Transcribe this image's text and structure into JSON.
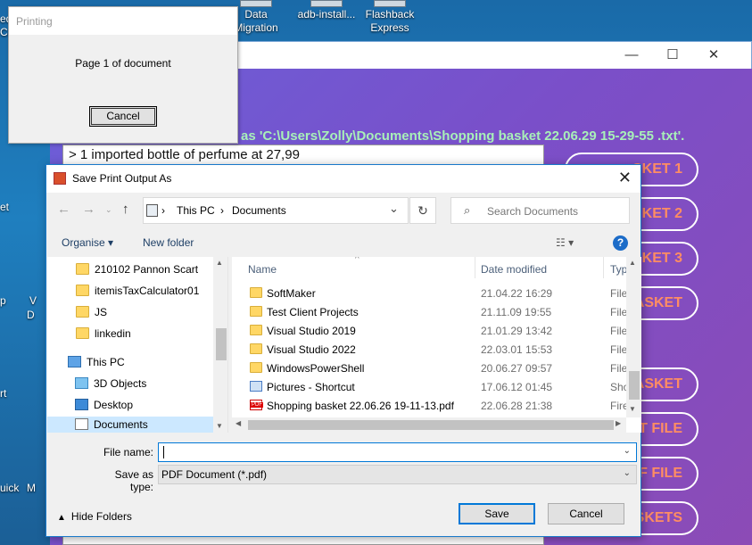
{
  "desktop": {
    "icons": [
      {
        "label": "Data\nMigration"
      },
      {
        "label": "adb-install..."
      },
      {
        "label": "Flashback\nExpress"
      }
    ],
    "edge_fragments": [
      "ed",
      "Ca",
      "et",
      "p",
      "V",
      "D",
      "rt",
      "uick",
      "M"
    ]
  },
  "app_window": {
    "minimize": "—",
    "maximize": "☐",
    "close": "✕",
    "save_path_text": "as 'C:\\Users\\Zolly\\Documents\\Shopping basket 22.06.29 15-29-55 .txt'.",
    "list_first_row": "> 1 imported bottle of perfume at 27,99",
    "pill_buttons": [
      "SKET 1",
      "SKET 2",
      "SKET 3",
      "/ BASKET",
      "BASKET",
      "XT FILE",
      "DF FILE",
      "SKETS"
    ],
    "accent_color": "#ff8d63"
  },
  "printing_dialog": {
    "title": "Printing",
    "message": "Page 1 of document",
    "cancel_label": "Cancel"
  },
  "save_dialog": {
    "title": "Save Print Output As",
    "close": "✕",
    "breadcrumb": {
      "root": "This PC",
      "sep": "›",
      "current": "Documents"
    },
    "search_placeholder": "Search Documents",
    "organise_label": "Organise ▾",
    "new_folder_label": "New folder",
    "help_label": "?",
    "nav_items": [
      {
        "label": "210102 Pannon Scart"
      },
      {
        "label": "itemisTaxCalculator01"
      },
      {
        "label": "JS"
      },
      {
        "label": "linkedin"
      },
      {
        "label": "This PC"
      },
      {
        "label": "3D Objects"
      },
      {
        "label": "Desktop"
      },
      {
        "label": "Documents"
      }
    ],
    "columns": {
      "name": "Name",
      "date": "Date modified",
      "type": "Typ"
    },
    "files": [
      {
        "name": "SoftMaker",
        "date": "21.04.22 16:29",
        "type": "File"
      },
      {
        "name": "Test Client Projects",
        "date": "21.11.09 19:55",
        "type": "File"
      },
      {
        "name": "Visual Studio 2019",
        "date": "21.01.29 13:42",
        "type": "File"
      },
      {
        "name": "Visual Studio 2022",
        "date": "22.03.01 15:53",
        "type": "File"
      },
      {
        "name": "WindowsPowerShell",
        "date": "20.06.27 09:57",
        "type": "File"
      },
      {
        "name": "Pictures - Shortcut",
        "date": "17.06.12 01:45",
        "type": "Sho"
      },
      {
        "name": "Shopping basket 22.06.26 19-11-13.pdf",
        "date": "22.06.28 21:38",
        "type": "Fire"
      }
    ],
    "file_name_label": "File name:",
    "file_name_value": "",
    "save_type_label": "Save as type:",
    "save_type_value": "PDF Document (*.pdf)",
    "hide_folders_label": "Hide Folders",
    "save_label": "Save",
    "cancel_label": "Cancel"
  }
}
